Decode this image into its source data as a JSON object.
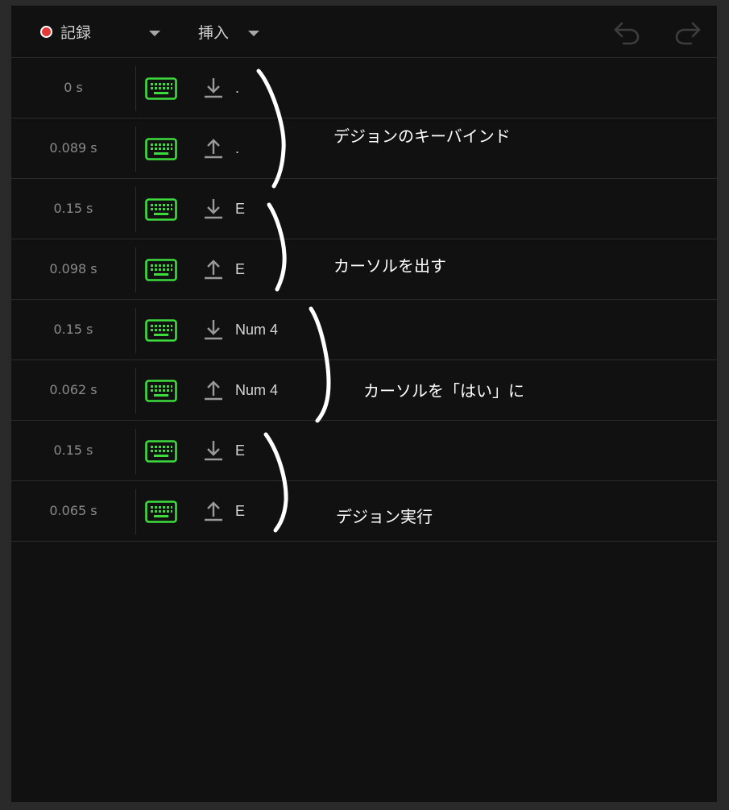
{
  "toolbar": {
    "record_label": "記録",
    "insert_label": "挿入",
    "colors": {
      "record_dot": "#e53935",
      "icon_disabled": "#3d3d3d"
    },
    "icons": {
      "undo": "undo-icon",
      "redo": "redo-icon"
    }
  },
  "rows": [
    {
      "time": "0 s",
      "action": "key-down",
      "key": "."
    },
    {
      "time": "0.089 s",
      "action": "key-up",
      "key": "."
    },
    {
      "time": "0.15 s",
      "action": "key-down",
      "key": "E"
    },
    {
      "time": "0.098 s",
      "action": "key-up",
      "key": "E"
    },
    {
      "time": "0.15 s",
      "action": "key-down",
      "key": "Num 4"
    },
    {
      "time": "0.062 s",
      "action": "key-up",
      "key": "Num 4"
    },
    {
      "time": "0.15 s",
      "action": "key-down",
      "key": "E"
    },
    {
      "time": "0.065 s",
      "action": "key-up",
      "key": "E"
    }
  ],
  "annotations": [
    "デジョンのキーバインド",
    "カーソルを出す",
    "カーソルを「はい」に",
    "デジョン実行"
  ],
  "colors": {
    "keyboard_icon": "#3ddc3d",
    "arrow_icon": "#9a9a9a",
    "panel_bg": "#111111"
  }
}
